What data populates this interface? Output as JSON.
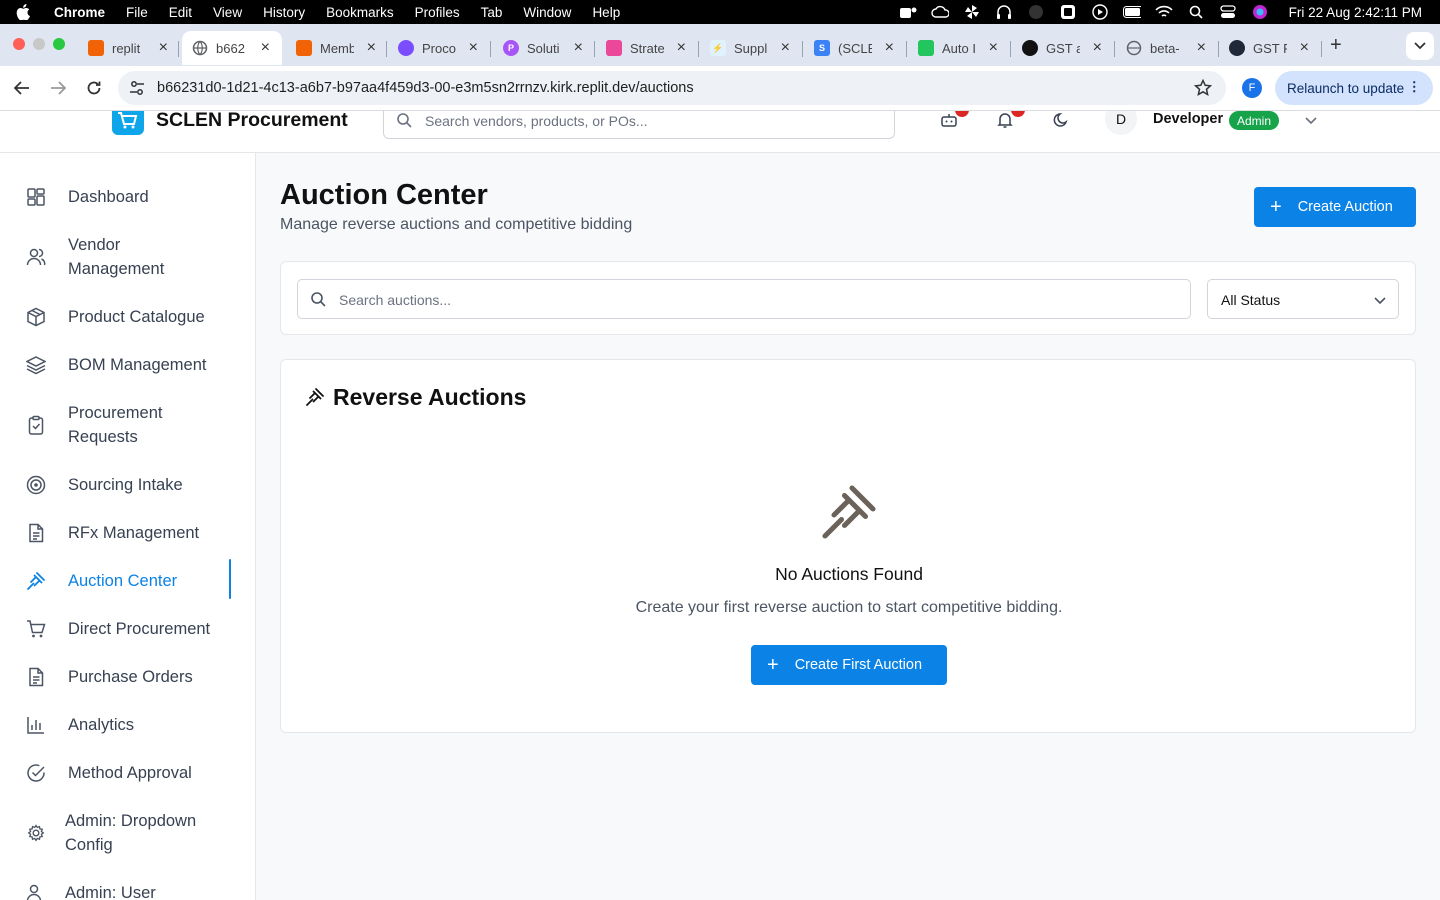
{
  "menubar": {
    "app": "Chrome",
    "items": [
      "File",
      "Edit",
      "View",
      "History",
      "Bookmarks",
      "Profiles",
      "Tab",
      "Window",
      "Help"
    ],
    "clock": "Fri 22 Aug  2:42:11 PM"
  },
  "tabs": [
    {
      "title": "replit",
      "icon": "replit-icon",
      "color": "#f26207"
    },
    {
      "title": "b662",
      "icon": "globe-icon",
      "color": "#5f6368",
      "active": true
    },
    {
      "title": "Memb",
      "icon": "replit-icon",
      "color": "#f26207"
    },
    {
      "title": "Proco",
      "icon": "circles-icon",
      "color": "#7c4dff"
    },
    {
      "title": "Soluti",
      "icon": "p-icon",
      "color": "#a855f7"
    },
    {
      "title": "Strate",
      "icon": "stack-icon",
      "color": "#ec4899"
    },
    {
      "title": "Suppl",
      "icon": "bolt-icon",
      "color": "#0ea5e9"
    },
    {
      "title": "(SCLE",
      "icon": "s-icon",
      "color": "#3b82f6"
    },
    {
      "title": "Auto I",
      "icon": "drive-icon",
      "color": "#22c55e"
    },
    {
      "title": "GST a",
      "icon": "openai-icon",
      "color": "#111111"
    },
    {
      "title": "beta-",
      "icon": "globe-icon",
      "color": "#5f6368"
    },
    {
      "title": "GST F",
      "icon": "clear-icon",
      "color": "#1f2937"
    }
  ],
  "browser": {
    "url": "b66231d0-1d21-4c13-a6b7-b97aa4f459d3-00-e3m5sn2rrnzv.kirk.replit.dev/auctions",
    "profile_initial": "F",
    "relaunch_label": "Relaunch to update"
  },
  "header": {
    "brand": "SCLEN Procurement",
    "search_placeholder": "Search vendors, products, or POs...",
    "avatar_initial": "D",
    "user_name": "Developer",
    "role": "Admin"
  },
  "sidebar": {
    "items": [
      {
        "label": "Dashboard",
        "icon": "dashboard-icon"
      },
      {
        "label": "Vendor Management",
        "icon": "users-icon"
      },
      {
        "label": "Product Catalogue",
        "icon": "package-icon"
      },
      {
        "label": "BOM Management",
        "icon": "layers-icon"
      },
      {
        "label": "Procurement Requests",
        "icon": "clipboard-check-icon"
      },
      {
        "label": "Sourcing Intake",
        "icon": "target-icon"
      },
      {
        "label": "RFx Management",
        "icon": "file-text-icon"
      },
      {
        "label": "Auction Center",
        "icon": "gavel-icon",
        "active": true
      },
      {
        "label": "Direct Procurement",
        "icon": "cart-icon"
      },
      {
        "label": "Purchase Orders",
        "icon": "file-text-icon"
      },
      {
        "label": "Analytics",
        "icon": "bar-chart-icon"
      },
      {
        "label": "Method Approval",
        "icon": "check-circle-icon"
      },
      {
        "label": "Admin: Dropdown Config",
        "icon": "gear-icon"
      },
      {
        "label": "Admin: User",
        "icon": "users-icon"
      }
    ]
  },
  "main": {
    "title": "Auction Center",
    "subtitle": "Manage reverse auctions and competitive bidding",
    "create_button": "Create Auction",
    "filter": {
      "search_placeholder": "Search auctions...",
      "status_value": "All Status"
    },
    "card": {
      "title": "Reverse Auctions",
      "empty_title": "No Auctions Found",
      "empty_desc": "Create your first reverse auction to start competitive bidding.",
      "empty_button": "Create First Auction"
    }
  },
  "colors": {
    "accent": "#0b82e6",
    "admin_badge": "#16a34a",
    "notification": "#dc2626"
  }
}
